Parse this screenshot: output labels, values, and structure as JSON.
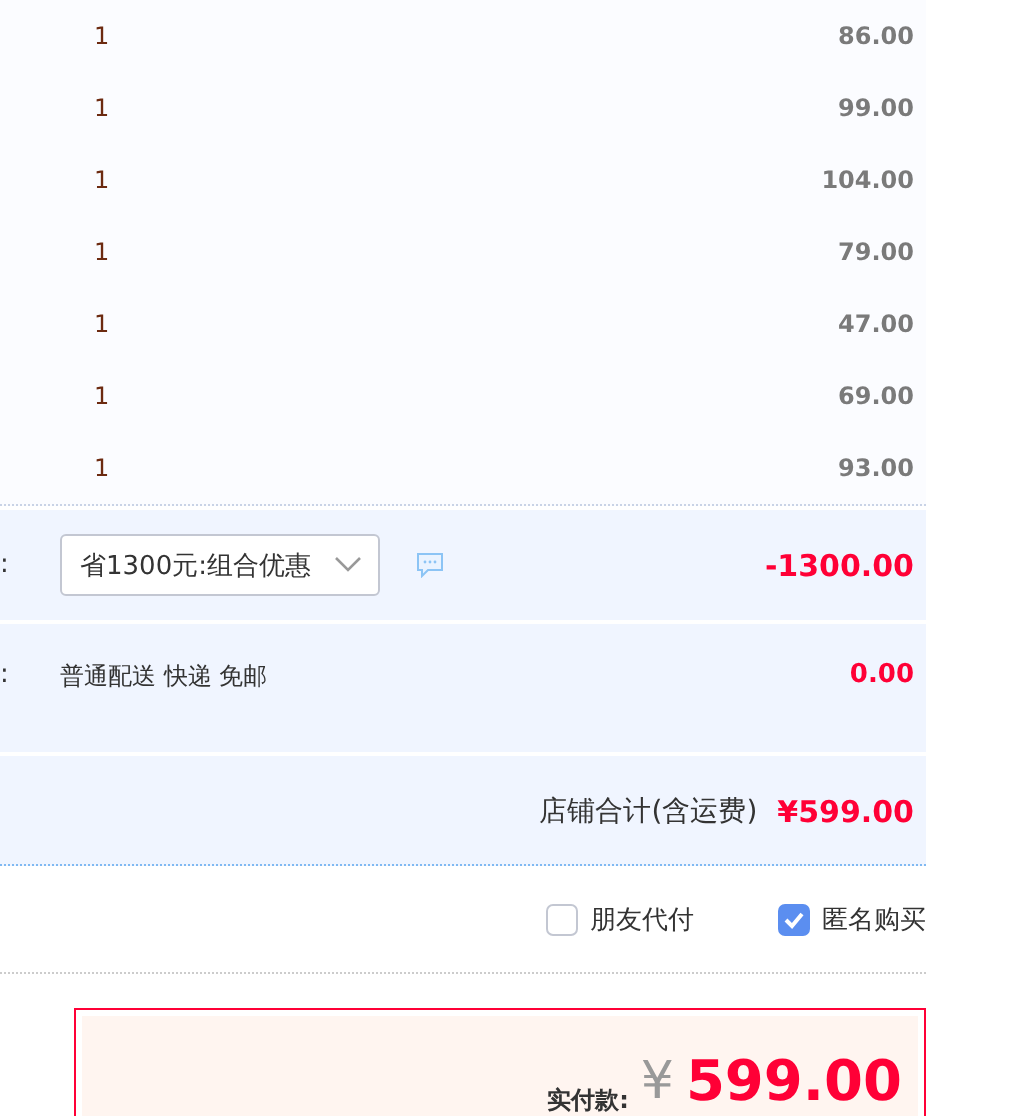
{
  "items": [
    {
      "quantity": "1",
      "price": "86.00"
    },
    {
      "quantity": "1",
      "price": "99.00"
    },
    {
      "quantity": "1",
      "price": "104.00"
    },
    {
      "quantity": "1",
      "price": "79.00"
    },
    {
      "quantity": "1",
      "price": "47.00"
    },
    {
      "quantity": "1",
      "price": "69.00"
    },
    {
      "quantity": "1",
      "price": "93.00"
    }
  ],
  "discount": {
    "label_tail": ":",
    "select_value": "省1300元:组合优惠",
    "amount": "-1300.00"
  },
  "shipping": {
    "label_tail": ":",
    "method": "普通配送 快递 免邮",
    "amount": "0.00"
  },
  "shop_total": {
    "label": "店铺合计(含运费)",
    "amount": "¥599.00"
  },
  "options": [
    {
      "label": "朋友代付",
      "checked": false
    },
    {
      "label": "匿名购买",
      "checked": true
    }
  ],
  "payment": {
    "label": "实付款:",
    "currency": "¥",
    "amount": "599.00"
  }
}
